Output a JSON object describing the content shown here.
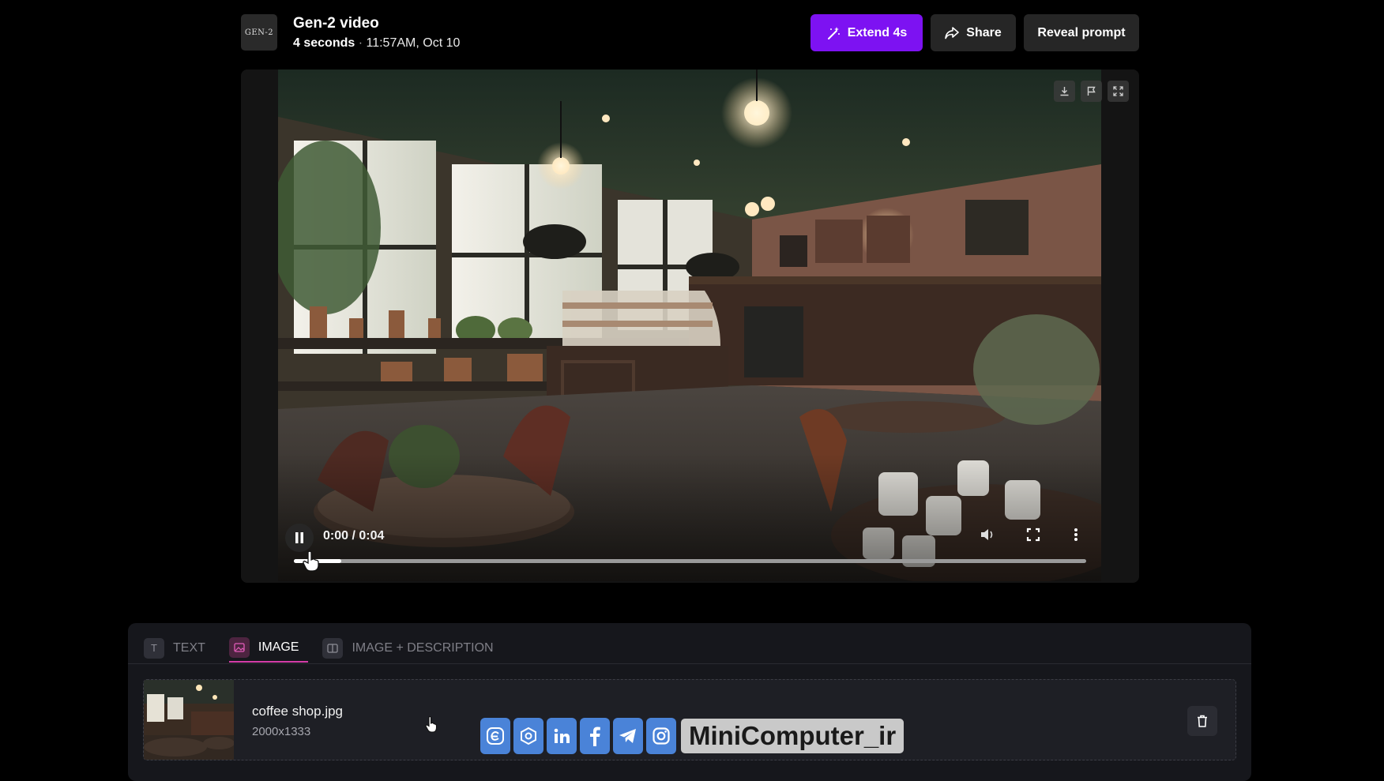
{
  "header": {
    "logo_text": "GEN-2",
    "title": "Gen-2 video",
    "duration": "4 seconds",
    "separator": "·",
    "timestamp": "11:57AM, Oct 10",
    "buttons": {
      "extend": "Extend 4s",
      "share": "Share",
      "reveal": "Reveal prompt"
    },
    "extend_color": "#7d12f2"
  },
  "video": {
    "toolbar_icons": [
      "download-icon",
      "flag-icon",
      "expand-icon"
    ],
    "time_display": "0:00 / 0:04",
    "progress_fraction": 0.06,
    "controls": [
      "pause-icon",
      "volume-icon",
      "fullscreen-icon",
      "more-vertical-icon"
    ]
  },
  "input_panel": {
    "tabs": [
      {
        "label": "TEXT",
        "icon": "text-icon",
        "active": false
      },
      {
        "label": "IMAGE",
        "icon": "image-icon",
        "active": true
      },
      {
        "label": "IMAGE + DESCRIPTION",
        "icon": "image-description-icon",
        "active": false
      }
    ],
    "accent": "#d43ca8",
    "file": {
      "name": "coffee shop.jpg",
      "dimensions": "2000x1333"
    }
  },
  "watermark": {
    "text": "MiniComputer_ir",
    "icons": [
      "eitaa-icon",
      "rubika-icon",
      "linkedin-icon",
      "facebook-icon",
      "telegram-icon",
      "instagram-icon"
    ]
  }
}
